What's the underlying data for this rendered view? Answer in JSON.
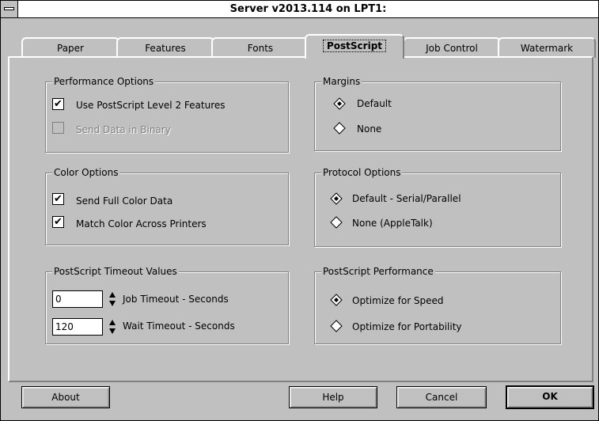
{
  "window": {
    "title": "Server v2013.114 on LPT1:"
  },
  "tabs": [
    {
      "label": "Paper",
      "active": false
    },
    {
      "label": "Features",
      "active": false
    },
    {
      "label": "Fonts",
      "active": false
    },
    {
      "label": "PostScript",
      "active": true
    },
    {
      "label": "Job Control",
      "active": false
    },
    {
      "label": "Watermark",
      "active": false
    }
  ],
  "performance": {
    "title": "Performance Options",
    "level2": {
      "label": "Use PostScript Level 2 Features",
      "checked": true
    },
    "binary": {
      "label": "Send Data in Binary",
      "checked": false,
      "disabled": true
    }
  },
  "color": {
    "title": "Color Options",
    "full_color": {
      "label": "Send Full Color Data",
      "checked": true
    },
    "match_color": {
      "label": "Match Color Across Printers",
      "checked": true
    }
  },
  "timeouts": {
    "title": "PostScript Timeout Values",
    "job": {
      "value": "0",
      "label": "Job Timeout - Seconds"
    },
    "wait": {
      "value": "120",
      "label": "Wait Timeout - Seconds"
    }
  },
  "margins": {
    "title": "Margins",
    "options": [
      {
        "label": "Default",
        "selected": true
      },
      {
        "label": "None",
        "selected": false
      }
    ]
  },
  "protocol": {
    "title": "Protocol Options",
    "options": [
      {
        "label": "Default - Serial/Parallel",
        "selected": true
      },
      {
        "label": "None (AppleTalk)",
        "selected": false
      }
    ]
  },
  "ps_performance": {
    "title": "PostScript Performance",
    "options": [
      {
        "label": "Optimize for Speed",
        "selected": true
      },
      {
        "label": "Optimize for Portability",
        "selected": false
      }
    ]
  },
  "buttons": {
    "about": "About",
    "help": "Help",
    "cancel": "Cancel",
    "ok": "OK"
  },
  "icons": {
    "checkmark": "✔"
  },
  "colors": {
    "face": "#c0c0c0",
    "shadow": "#808080",
    "highlight": "#ffffff"
  }
}
